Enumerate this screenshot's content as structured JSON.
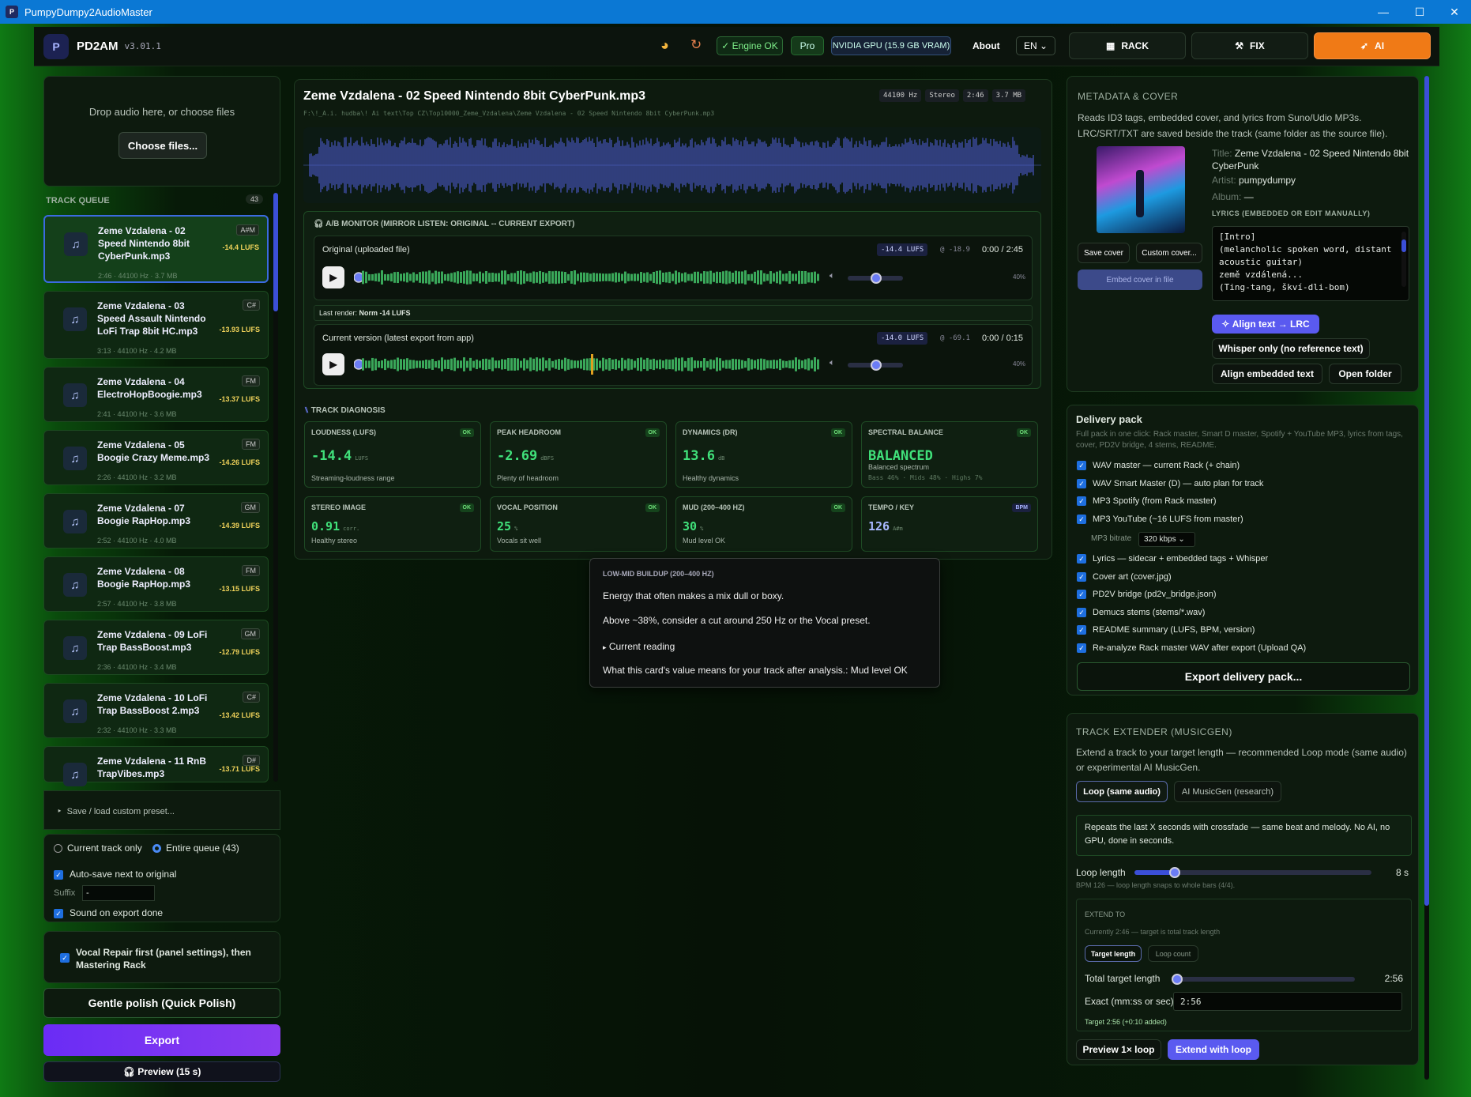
{
  "window": {
    "title": "PumpyDumpy2AudioMaster"
  },
  "header": {
    "brand": "PD2AM",
    "version": "v3.01.1",
    "engine": "✓ Engine OK",
    "pro": "Pro",
    "gpu": "NVIDIA GPU (15.9 GB VRAM)",
    "about": "About",
    "lang": "EN",
    "modes": [
      "RACK",
      "FIX",
      "AI"
    ]
  },
  "drop": {
    "text": "Drop audio here, or choose files",
    "button": "Choose files..."
  },
  "queue": {
    "title": "TRACK QUEUE",
    "count": "43",
    "items": [
      {
        "name": "Zeme Vzdalena - 02 Speed Nintendo 8bit CyberPunk.mp3",
        "meta": "2:46 · 44100 Hz · 3.7 MB",
        "key": "A#M",
        "lufs": "-14.4 LUFS"
      },
      {
        "name": "Zeme Vzdalena - 03 Speed Assault Nintendo LoFi Trap 8bit HC.mp3",
        "meta": "3:13 · 44100 Hz · 4.2 MB",
        "key": "C#",
        "lufs": "-13.93 LUFS"
      },
      {
        "name": "Zeme Vzdalena - 04 ElectroHopBoogie.mp3",
        "meta": "2:41 · 44100 Hz · 3.6 MB",
        "key": "FM",
        "lufs": "-13.37 LUFS"
      },
      {
        "name": "Zeme Vzdalena - 05 Boogie Crazy Meme.mp3",
        "meta": "2:26 · 44100 Hz · 3.2 MB",
        "key": "FM",
        "lufs": "-14.26 LUFS"
      },
      {
        "name": "Zeme Vzdalena - 07 Boogie RapHop.mp3",
        "meta": "2:52 · 44100 Hz · 4.0 MB",
        "key": "GM",
        "lufs": "-14.39 LUFS"
      },
      {
        "name": "Zeme Vzdalena - 08 Boogie RapHop.mp3",
        "meta": "2:57 · 44100 Hz · 3.8 MB",
        "key": "FM",
        "lufs": "-13.15 LUFS"
      },
      {
        "name": "Zeme Vzdalena - 09 LoFi Trap BassBoost.mp3",
        "meta": "2:36 · 44100 Hz · 3.4 MB",
        "key": "GM",
        "lufs": "-12.79 LUFS"
      },
      {
        "name": "Zeme Vzdalena - 10 LoFi Trap BassBoost 2.mp3",
        "meta": "2:32 · 44100 Hz · 3.3 MB",
        "key": "C#",
        "lufs": "-13.42 LUFS"
      },
      {
        "name": "Zeme Vzdalena - 11 RnB TrapVibes.mp3",
        "meta": "",
        "key": "D#",
        "lufs": "-13.71 LUFS"
      }
    ]
  },
  "leftbottom": {
    "preset": "Save / load custom preset...",
    "scope_current": "Current track only",
    "scope_queue": "Entire queue (43)",
    "autosave": "Auto-save next to original",
    "suffix_label": "Suffix",
    "suffix_value": "-",
    "sound": "Sound on export done",
    "vocal": "Vocal Repair first (panel settings), then Mastering Rack",
    "gentle": "Gentle polish (Quick Polish)",
    "export": "Export",
    "preview": "Preview (15 s)"
  },
  "track": {
    "title": "Zeme Vzdalena - 02 Speed Nintendo 8bit CyberPunk.mp3",
    "path": "F:\\!_A.i. hudba\\! Ai text\\Top CZ\\Top10000_Zeme_Vzdalena\\Zeme Vzdalena - 02 Speed Nintendo 8bit CyberPunk.mp3",
    "rate": "44100 Hz",
    "ch": "Stereo",
    "dur": "2:46",
    "size": "3.7 MB"
  },
  "ab": {
    "title": "A/B MONITOR (MIRROR LISTEN: ORIGINAL -- CURRENT EXPORT)",
    "orig": {
      "label": "Original (uploaded file)",
      "lufs": "-14.4 LUFS",
      "peak": "@ -18.9",
      "time": "0:00 / 2:45",
      "vol": "40%"
    },
    "last": "Last render:",
    "last_v": "Norm -14 LUFS",
    "cur": {
      "label": "Current version (latest export from app)",
      "lufs": "-14.0 LUFS",
      "peak": "@ -69.1",
      "time": "0:00 / 0:15",
      "vol": "40%"
    }
  },
  "diag": {
    "title": "TRACK DIAGNOSIS",
    "cards": [
      {
        "t": "LOUDNESS (LUFS)",
        "v": "-14.4",
        "u": "LUFS",
        "s": "Streaming-loudness range",
        "b": "OK"
      },
      {
        "t": "PEAK HEADROOM",
        "v": "-2.69",
        "u": "dBFS",
        "s": "Plenty of headroom",
        "b": "OK"
      },
      {
        "t": "DYNAMICS (DR)",
        "v": "13.6",
        "u": "dB",
        "s": "Healthy dynamics",
        "b": "OK"
      },
      {
        "t": "SPECTRAL BALANCE",
        "v": "BALANCED",
        "u": "",
        "s": "Balanced spectrum",
        "s2": "Bass 46% · Mids 48% · Highs 7%",
        "b": "OK"
      },
      {
        "t": "STEREO IMAGE",
        "v": "0.91",
        "u": "corr.",
        "s": "Healthy stereo",
        "b": "OK"
      },
      {
        "t": "VOCAL POSITION",
        "v": "25",
        "u": "%",
        "s": "Vocals sit well",
        "b": "OK"
      },
      {
        "t": "MUD (200–400 HZ)",
        "v": "30",
        "u": "%",
        "s": "Mud level OK",
        "b": "OK"
      },
      {
        "t": "TEMPO / KEY",
        "v": "126",
        "u": "A#m",
        "s": "",
        "b": "BPM"
      }
    ]
  },
  "tooltip": {
    "title": "LOW-MID BUILDUP (200–400 HZ)",
    "l1": "Energy that often makes a mix dull or boxy.",
    "l2": "Above ~38%, consider a cut around 250 Hz or the Vocal preset.",
    "l3": "Current reading",
    "l4": "What this card's value means for your track after analysis.: Mud level OK"
  },
  "meta": {
    "title": "METADATA & COVER",
    "desc": "Reads ID3 tags, embedded cover, and lyrics from Suno/Udio MP3s. LRC/SRT/TXT are saved beside the track (same folder as the source file).",
    "title_l": "Title:",
    "title_v": "Zeme Vzdalena - 02 Speed Nintendo 8bit CyberPunk",
    "artist_l": "Artist:",
    "artist_v": "pumpydumpy",
    "album_l": "Album:",
    "album_v": "—",
    "lyrics_l": "LYRICS (EMBEDDED OR EDIT MANUALLY)",
    "lyrics": [
      "[Intro]",
      "(melancholic spoken word, distant",
      "acoustic guitar)",
      "země vzdálená...",
      "(Ting-tang, škví-dli-bom)"
    ],
    "save": "Save cover",
    "custom": "Custom cover...",
    "embed": "Embed cover in file",
    "align": "Align text → LRC",
    "whisper": "Whisper only (no reference text)",
    "alignemb": "Align embedded text",
    "open": "Open folder"
  },
  "delivery": {
    "title": "Delivery pack",
    "desc": "Full pack in one click: Rack master, Smart D master, Spotify + YouTube MP3, lyrics from tags, cover, PD2V bridge, 4 stems, README.",
    "items": [
      "WAV master — current Rack (+ chain)",
      "WAV Smart Master (D) — auto plan for track",
      "MP3 Spotify (from Rack master)",
      "MP3 YouTube (~16 LUFS from master)"
    ],
    "bitrate_l": "MP3 bitrate",
    "bitrate": "320 kbps",
    "items2": [
      "Lyrics — sidecar + embedded tags + Whisper",
      "Cover art (cover.jpg)",
      "PD2V bridge (pd2v_bridge.json)",
      "Demucs stems (stems/*.wav)",
      "README summary (LUFS, BPM, version)",
      "Re-analyze Rack master WAV after export (Upload QA)"
    ],
    "export": "Export delivery pack..."
  },
  "extender": {
    "title": "TRACK EXTENDER (MUSICGEN)",
    "desc": "Extend a track to your target length — recommended Loop mode (same audio) or experimental AI MusicGen.",
    "loop": "Loop (same audio)",
    "ai": "AI MusicGen (research)",
    "info": "Repeats the last X seconds with crossfade — same beat and melody. No AI, no GPU, done in seconds.",
    "looplen_l": "Loop length",
    "looplen_v": "8 s",
    "looplen_fill": 0.17,
    "note": "BPM 126 — loop length snaps to whole bars (4/4).",
    "extend_to": "EXTEND TO",
    "currently": "Currently 2:46 — target is total track length",
    "tab1": "Target length",
    "tab2": "Loop count",
    "total_l": "Total target length",
    "total_v": "2:56",
    "total_fill": 0.02,
    "exact_l": "Exact (mm:ss or sec)",
    "exact_v": "2:56",
    "target": "Target 2:56 (+0:10 added)",
    "preview": "Preview 1× loop",
    "extend": "Extend with loop"
  }
}
